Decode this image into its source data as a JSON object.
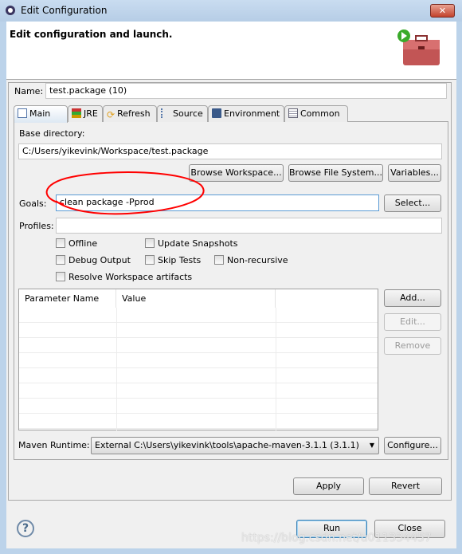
{
  "window": {
    "title": "Edit Configuration",
    "close_glyph": "✕"
  },
  "header": {
    "title": "Edit configuration and launch."
  },
  "name": {
    "label": "Name:",
    "value": "test.package (10)"
  },
  "tabs": [
    {
      "label": "Main",
      "icon": "main-tab-icon"
    },
    {
      "label": "JRE",
      "icon": "books-icon"
    },
    {
      "label": "Refresh",
      "icon": "refresh-icon"
    },
    {
      "label": "Source",
      "icon": "source-icon"
    },
    {
      "label": "Environment",
      "icon": "environment-icon"
    },
    {
      "label": "Common",
      "icon": "common-icon"
    }
  ],
  "main": {
    "base_dir_label": "Base directory:",
    "base_dir_value": "C:/Users/yikevink/Workspace/test.package",
    "browse_workspace": "Browse Workspace...",
    "browse_fs": "Browse File System...",
    "variables": "Variables...",
    "goals_label": "Goals:",
    "goals_value": "clean package -Pprod",
    "select": "Select...",
    "profiles_label": "Profiles:",
    "profiles_value": "",
    "checkboxes": {
      "offline": "Offline",
      "update_snapshots": "Update Snapshots",
      "debug_output": "Debug Output",
      "skip_tests": "Skip Tests",
      "non_recursive": "Non-recursive",
      "resolve_workspace": "Resolve Workspace artifacts"
    },
    "table": {
      "columns": [
        "Parameter Name",
        "Value",
        ""
      ],
      "rows": []
    },
    "add": "Add...",
    "edit": "Edit...",
    "remove": "Remove",
    "runtime_label": "Maven Runtime:",
    "runtime_value": "External C:\\Users\\yikevink\\tools\\apache-maven-3.1.1 (3.1.1)",
    "configure": "Configure..."
  },
  "apply": "Apply",
  "revert": "Revert",
  "run": "Run",
  "close": "Close",
  "help_glyph": "?",
  "watermark": "https://blog.csdn.net/u011334457",
  "annotation_color": "#ff0000"
}
